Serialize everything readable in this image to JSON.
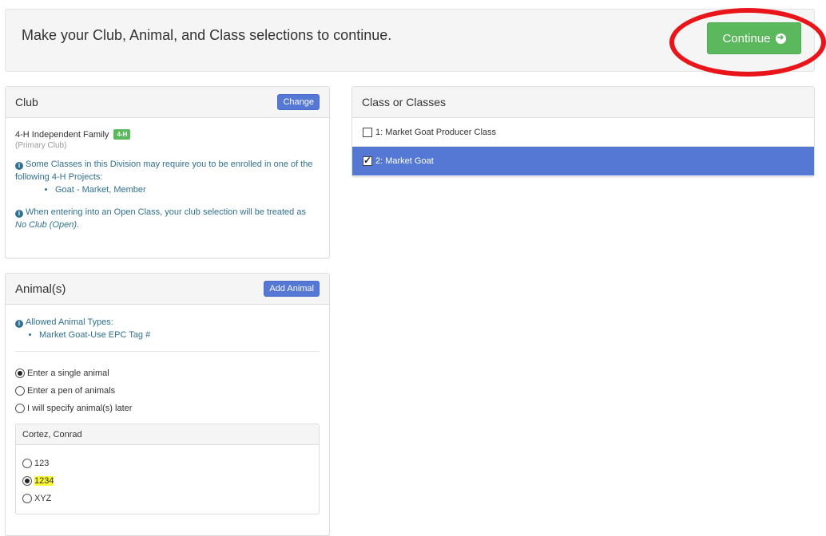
{
  "top": {
    "message": "Make your Club, Animal, and Class selections to continue.",
    "continue_label": "Continue"
  },
  "club": {
    "title": "Club",
    "change_label": "Change",
    "club_name": "4-H Independent Family",
    "badge": "4-H",
    "primary_note": "(Primary Club)",
    "info1": "Some Classes in this Division may require you to be enrolled in one of the following 4-H Projects:",
    "projects": [
      "Goat - Market, Member"
    ],
    "info2_prefix": "When entering into an Open Class, your club selection will be treated as ",
    "info2_em": "No Club (Open)",
    "info2_suffix": "."
  },
  "animals": {
    "title": "Animal(s)",
    "add_label": "Add Animal",
    "allowed_label": "Allowed Animal Types:",
    "allowed_types": [
      "Market Goat-Use EPC Tag #"
    ],
    "modes": [
      {
        "label": "Enter a single animal",
        "selected": true
      },
      {
        "label": "Enter a pen of animals",
        "selected": false
      },
      {
        "label": "I will specify animal(s) later",
        "selected": false
      }
    ],
    "owner": "Cortez, Conrad",
    "tags": [
      {
        "label": "123",
        "selected": false
      },
      {
        "label": "1234",
        "selected": true
      },
      {
        "label": "XYZ",
        "selected": false
      }
    ]
  },
  "classes": {
    "title": "Class or Classes",
    "items": [
      {
        "label": "1: Market Goat Producer Class",
        "checked": false
      },
      {
        "label": "2: Market Goat",
        "checked": true
      }
    ]
  },
  "colors": {
    "accent_blue": "#5578d5",
    "success_green": "#5cb85c",
    "annotation_red": "#e8161b",
    "highlight_yellow": "#fbf731"
  }
}
